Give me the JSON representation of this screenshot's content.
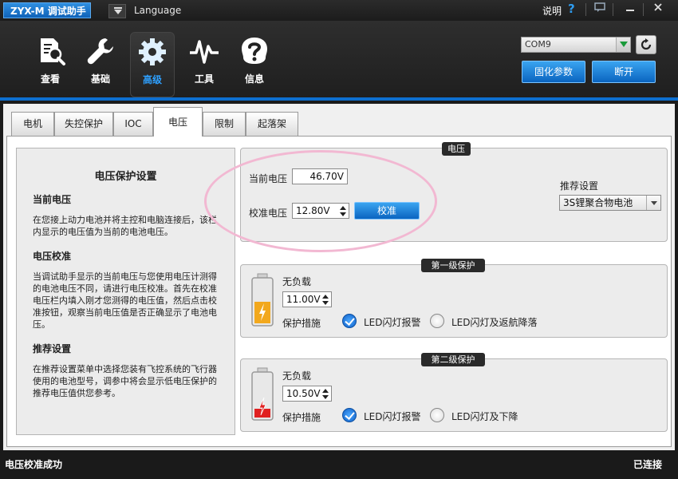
{
  "app": {
    "title": "ZYX-M 调试助手",
    "language_label": "Language",
    "help_label": "说明",
    "help_icon": "?",
    "accent_color": "#0d6fd0"
  },
  "toolbar": {
    "items": [
      {
        "label": "查看",
        "icon": "search-doc-icon"
      },
      {
        "label": "基础",
        "icon": "wrench-icon"
      },
      {
        "label": "高级",
        "icon": "gear-icon",
        "active": true
      },
      {
        "label": "工具",
        "icon": "pulse-icon"
      },
      {
        "label": "信息",
        "icon": "info-icon"
      }
    ],
    "com_port": "COM9",
    "solidify_label": "固化参数",
    "disconnect_label": "断开"
  },
  "tabs": [
    {
      "label": "电机"
    },
    {
      "label": "失控保护"
    },
    {
      "label": "IOC"
    },
    {
      "label": "电压",
      "active": true
    },
    {
      "label": "限制"
    },
    {
      "label": "起落架"
    }
  ],
  "help_panel": {
    "title": "电压保护设置",
    "sections": [
      {
        "heading": "当前电压",
        "text": "在您接上动力电池并将主控和电脑连接后，该栏内显示的电压值为当前的电池电压。"
      },
      {
        "heading": "电压校准",
        "text": "当调试助手显示的当前电压与您使用电压计测得的电池电压不同，请进行电压校准。首先在校准电压栏内填入刚才您测得的电压值，然后点击校准按钮，观察当前电压值是否正确显示了电池电压。"
      },
      {
        "heading": "推荐设置",
        "text": "在推荐设置菜单中选择您装有飞控系统的飞行器使用的电池型号，调参中将会显示低电压保护的推荐电压值供您参考。"
      }
    ]
  },
  "voltage_group": {
    "tag": "电压",
    "current_label": "当前电压",
    "current_value": "46.70V",
    "calib_label": "校准电压",
    "calib_value": "12.80V",
    "calib_button": "校准",
    "preset_label": "推荐设置",
    "preset_value": "3S锂聚合物电池"
  },
  "level1": {
    "tag": "第一级保护",
    "noload_label": "无负载",
    "noload_value": "11.00V",
    "measure_label": "保护措施",
    "option_a": "LED闪灯报警",
    "option_b": "LED闪灯及返航降落",
    "selected": "a",
    "battery_color": "#f2a81d",
    "battery_fill": 0.45
  },
  "level2": {
    "tag": "第二级保护",
    "noload_label": "无负载",
    "noload_value": "10.50V",
    "measure_label": "保护措施",
    "option_a": "LED闪灯报警",
    "option_b": "LED闪灯及下降",
    "selected": "a",
    "battery_color": "#e02020",
    "battery_fill": 0.2
  },
  "status": {
    "left": "电压校准成功",
    "right": "已连接"
  }
}
